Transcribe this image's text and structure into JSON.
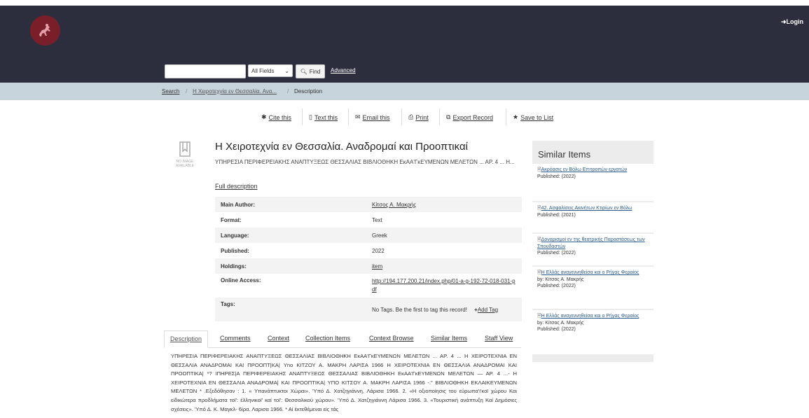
{
  "header": {
    "login_label": "Login"
  },
  "search": {
    "value": "",
    "field_select": "All Fields",
    "find_label": "Find",
    "advanced_label": "Advanced"
  },
  "breadcrumb": {
    "items": [
      "Search",
      "Η Χειροτεχνία εν Θεσσαλία. Ανα...",
      "Description"
    ]
  },
  "toolbar": {
    "items": [
      {
        "label": "Cite this",
        "icon": "asterisk-icon"
      },
      {
        "label": "Text this",
        "icon": "phone-icon"
      },
      {
        "label": "Email this",
        "icon": "envelope-icon"
      },
      {
        "label": "Print",
        "icon": "printer-icon"
      },
      {
        "label": "Export Record",
        "icon": "external-link-icon"
      },
      {
        "label": "Save to List",
        "icon": "star-icon"
      }
    ]
  },
  "record": {
    "no_image_text": "NO IMAGE AVAILABLE",
    "title": "Η Χειροτεχνία εν Θεσσαλία. Αναδρομαί και Προοπτικαί",
    "subtitle": "ΥΠΗΡΕΣΙΑ ΠΕΡΙΦΕΡΕΙΑΚΗΣ ΑΝΑΠΤΥΞΕΩΣ ΘΕΣΣΑΛΙΑΣ ΒΙΒΛΙΟΘΗΚΗ ΕκΑΑ'ΓκΕΥΜΕΝΩΝ ΜΕΛΕΤΩΝ ... ΑΡ. 4 ... Η...",
    "full_description_label": "Full description",
    "details": [
      {
        "label": "Main Author:",
        "value": "Κίτσος Α. Μακρής",
        "link": true
      },
      {
        "label": "Format:",
        "value": "Text",
        "link": false
      },
      {
        "label": "Language:",
        "value": "Greek",
        "link": false
      },
      {
        "label": "Published:",
        "value": "2022",
        "link": false
      },
      {
        "label": "Holdings:",
        "value": "item",
        "link": true
      },
      {
        "label": "Online Access:",
        "value": "http://194.177.200.21/index.php/01-a-g-192-72-018-031-pdf",
        "link": true
      }
    ],
    "tags_label": "Tags:",
    "tags_text": "No Tags. Be the first to tag this record!",
    "add_tag_label": "Add Tag"
  },
  "tabs": [
    "Description",
    "Comments",
    "Context",
    "Collection Items",
    "Context Browse",
    "Similar Items",
    "Staff View"
  ],
  "description_text": "ΥΠΗΡΕΣΙΑ ΠΕΡΙΦΕΡΕΙΑΚΗΣ ΑΝΑΠΤΥΞΕΩΣ ΘΕΣΣΑΛΙΑΣ ΒΙΒΛΙΟΘΗΚΗ ΕκΑΑ'ΓκΕΥΜΕΝΩΝ ΜΕΛΕΤΩΝ ... ΑΡ. 4 ... Η ΧΕΙΡΟΤΕΧΝΙΑ ΕΝ ΘΕΣΣΑΛΙΑ ΑΝΑΔΡΟΜΑΙ ΚΑΙ ΠΡΟΟΠΤ|ΚΑ| Yno ΚΙΤΖΟΥ Α. ΜΑΚΡΗ ΛΑΡΙΣΑ 1966 Η ΧΕΙΡΟΤΕΧΝΙΑ ΕΝ ΘΕΣΣΑΛΙΑ ΑΝΑΔΡΟΜΑΙ ΚΑΙ ΠΡΟΟΠΤΙΚΑ| *? ΙΠΗΡΕΣ|Α ΠΕΡΙΦΕΡΕΙΑΚΗΣ ΑΝΑΠΤΥΞΕΩΣ ΘΕΣΣΑΛΙΑΣ ΒΙΒΛΙΟΘΗΚΗ ΕκΑΑ'ΓκΕΥΜΕΝΩΝ ΜΕΛΕΤΩΝ — ΑΡ. 4 ...- Η ΧΕΙΡΟΤΕΧΝΙΑ ΕΝ ΘΕΣΣΑΛΙΑ ΑΝΑΔΡΟΜΑ| ΚΑΙ ΠΡΟΟΠΤΙΚΑ| ΥΠΟ ΚΙΤΣΟΥ Α. ΜΑΚΡΗ ΛΑΡΙΣΑ 1966 -.\" ΒΙΒΛΙΟΘΗΚΗ ΕΚΛΑΙΚΕΥΜΕΝΩΝ ΜΕΛΕΤΩΝ * .Εξεδόθησαν : 1. « Υπανάπτυκτοι Χώραι». 'Υπό Δ. Χατζηγιάννη, Λάρισα 1966. 2. «Η οξιοποίησις του εύρωπα'ι'κοϊ χώρου Και είδικώτερα προδλήματα τοϊ': έλληνικοϊ' καί τοϊ': Θεσσαλικού χώρου». 'Υπό Δ. Χατζηγιάννη Λάρισα 1966. 3. «Τουριστική ανάπτυξη Καί Δημόσιες σχέσεις». 'Υπό Δ. Κ. Μαγκλ- 6ίρα. Λαρισα 1966. * Αί έκτεθέμεναι είς τάς",
  "similar_items": {
    "heading": "Similar Items",
    "items": [
      {
        "title": "Ακρόασις εν Βόλω Επιτροπών εργατών",
        "author": "",
        "published": "Published: (2022)"
      },
      {
        "title": "42. Ασφαλίσεις Ακινήτων Κτιρίων εν Βόλω",
        "author": "",
        "published": "Published: (2021)"
      },
      {
        "title": "Δοναρισμοί εν της θεατρικής Παραστάσεως των Σπουδαστών",
        "author": "",
        "published": "Published: (2022)"
      },
      {
        "title": "Η Ελλάς αναγεννηθείσα και ο Ρήγας Φεραίος",
        "author": "by: Κίτσος Α. Μακρής",
        "published": "Published: (2022)"
      },
      {
        "title": "Η Ελλάς αναγεννηθείσα και ο Ρήγας Φεραίος",
        "author": "by: Κίτσος Α. Μακρής",
        "published": "Published: (2022)"
      }
    ]
  }
}
